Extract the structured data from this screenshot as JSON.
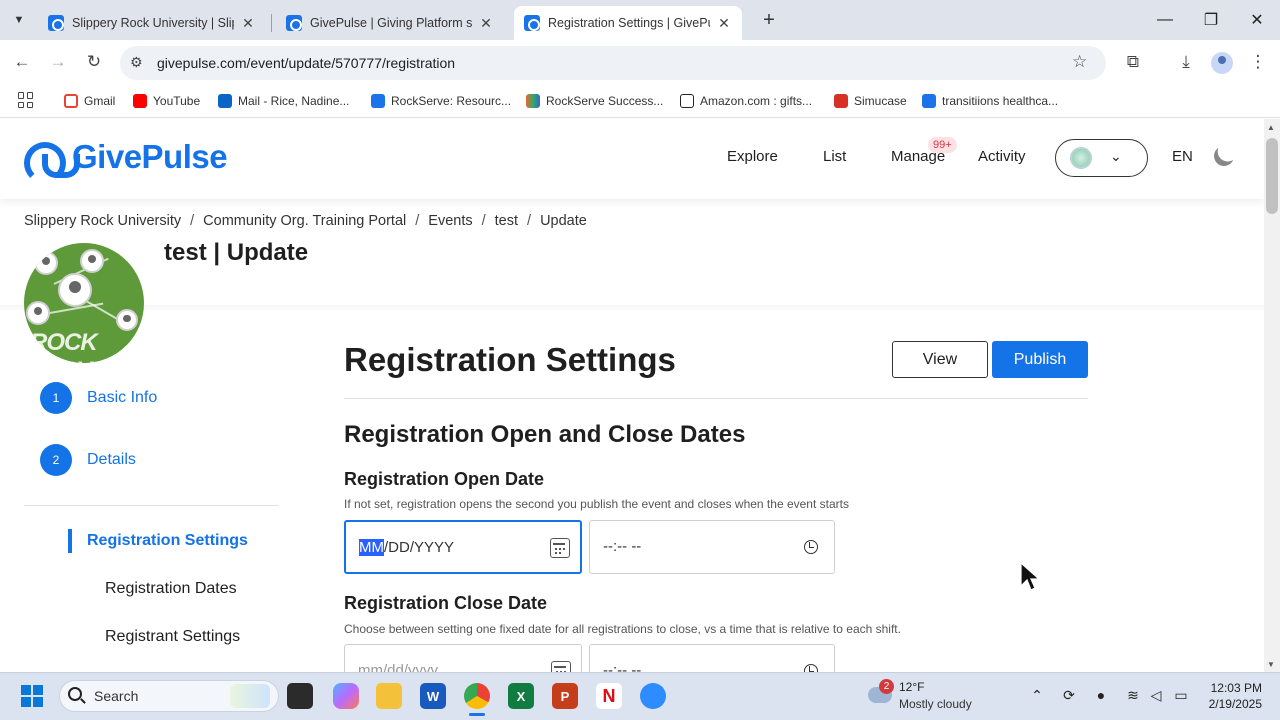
{
  "browser": {
    "tabs": [
      {
        "title": "Slippery Rock University | Slippery Rock University",
        "active": false
      },
      {
        "title": "GivePulse | Giving Platform support",
        "active": false
      },
      {
        "title": "Registration Settings | GivePulse",
        "active": true
      }
    ],
    "url": "givepulse.com/event/update/570777/registration",
    "bookmarks": [
      "Gmail",
      "YouTube",
      "Mail - Rice, Nadine...",
      "RockServe: Resourc...",
      "RockServe Success...",
      "Amazon.com : gifts...",
      "Simucase",
      "transitiions healthca..."
    ]
  },
  "site": {
    "logo": "GivePulse",
    "nav": [
      "Explore",
      "List",
      "Manage",
      "Activity"
    ],
    "manage_badge": "99+",
    "language": "EN"
  },
  "breadcrumb": [
    "Slippery Rock University",
    "Community Org. Training Portal",
    "Events",
    "test",
    "Update"
  ],
  "page_title": "test | Update",
  "org_avatar_text": "ROCK SERVE",
  "sidebar": {
    "steps": [
      {
        "number": "1",
        "label": "Basic Info"
      },
      {
        "number": "2",
        "label": "Details"
      }
    ],
    "active": "Registration Settings",
    "sub_items": [
      "Registration Dates",
      "Registrant Settings"
    ]
  },
  "main": {
    "title": "Registration Settings",
    "view_label": "View",
    "publish_label": "Publish",
    "section_title": "Registration Open and Close Dates",
    "open_date": {
      "label": "Registration Open Date",
      "help": "If not set, registration opens the second you publish the event and closes when the event starts",
      "date_selected": "MM",
      "date_rest": "/DD/YYYY",
      "time_placeholder": "--:-- --"
    },
    "close_date": {
      "label": "Registration Close Date",
      "help": "Choose between setting one fixed date for all registrations to close, vs a time that is relative to each shift.",
      "date_placeholder": "mm/dd/yyyy",
      "time_placeholder": "--:-- --"
    }
  },
  "taskbar": {
    "search": "Search",
    "weather_badge": "2",
    "temperature": "12°F",
    "condition": "Mostly cloudy",
    "time": "12:03 PM",
    "date": "2/19/2025"
  },
  "colors": {
    "brand_blue": "#1473e6",
    "tabstrip": "#dfe3eb",
    "taskbar": "#dbe3f0"
  }
}
